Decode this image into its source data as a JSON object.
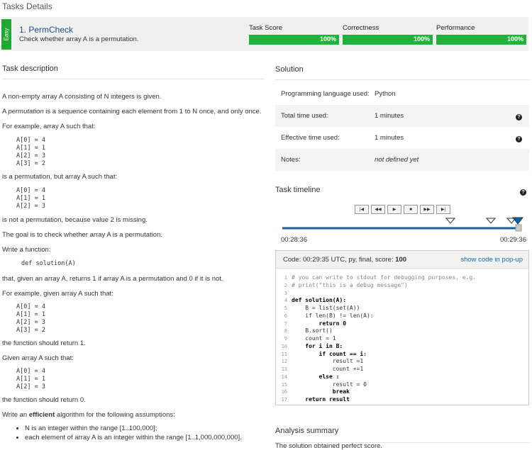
{
  "page_title": "Tasks Details",
  "task": {
    "difficulty": "Easy",
    "name": "1. PermCheck",
    "subtitle": "Check whether array A is a permutation.",
    "metrics": [
      {
        "label": "Task Score",
        "value": "100%",
        "fraction": 1.0
      },
      {
        "label": "Correctness",
        "value": "100%",
        "fraction": 1.0
      },
      {
        "label": "Performance",
        "value": "100%",
        "fraction": 1.0
      }
    ]
  },
  "description": {
    "title": "Task description",
    "p1": "A non-empty array A consisting of N integers is given.",
    "p2_pre": "A ",
    "p2_em": "permutation",
    "p2_post": " is a sequence containing each element from 1 to N once, and only once.",
    "p3": "For example, array A such that:",
    "ex1": [
      "A[0] = 4",
      "A[1] = 1",
      "A[2] = 3",
      "A[3] = 2"
    ],
    "p4": "is a permutation, but array A such that:",
    "ex2": [
      "A[0] = 4",
      "A[1] = 1",
      "A[2] = 3"
    ],
    "p5": "is not a permutation, because value 2 is missing.",
    "p6": "The goal is to check whether array A is a permutation.",
    "p7": "Write a function:",
    "signature": "def solution(A)",
    "p8": "that, given an array A, returns 1 if array A is a permutation and 0 if it is not.",
    "p9": "For example, given array A such that:",
    "ex3": [
      "A[0] = 4",
      "A[1] = 1",
      "A[2] = 3",
      "A[3] = 2"
    ],
    "p10": "the function should return 1.",
    "p11": "Given array A such that:",
    "ex4": [
      "A[0] = 4",
      "A[1] = 1",
      "A[2] = 3"
    ],
    "p12": "the function should return 0.",
    "p13_pre": "Write an ",
    "p13_strong": "efficient",
    "p13_post": " algorithm for the following assumptions:",
    "bullets": [
      "N is an integer within the range [1..100,000];",
      "each element of array A is an integer within the range [1..1,000,000,000]."
    ]
  },
  "solution": {
    "title": "Solution",
    "rows": [
      {
        "key": "Programming language used:",
        "value": "Python",
        "help": false
      },
      {
        "key": "Total time used:",
        "value": "1 minutes",
        "help": true
      },
      {
        "key": "Effective time used:",
        "value": "1 minutes",
        "help": true
      },
      {
        "key": "Notes:",
        "value": "not defined yet",
        "help": false
      }
    ]
  },
  "timeline": {
    "title": "Task timeline",
    "controls": [
      "first",
      "rewind",
      "play",
      "stop",
      "forward",
      "last"
    ],
    "start_time": "00:28:36",
    "end_time": "00:29:36"
  },
  "code": {
    "header": "Code: 00:29:35 UTC, py, final, score: ",
    "score": "100",
    "popup_link": "show code in pop-up",
    "lines": [
      "# you can write to stdout for debugging purposes, e.g.",
      "# print(\"this is a debug message\")",
      "",
      "def solution(A):",
      "    B = list(set(A))",
      "    if len(B) != len(A):",
      "        return 0",
      "    B.sort()",
      "    count = 1",
      "    for i in B:",
      "        if count == i:",
      "            result =1",
      "            count +=1",
      "        else :",
      "            result = 0",
      "            break",
      "    return result"
    ]
  },
  "analysis": {
    "title": "Analysis summary",
    "text": "The solution obtained perfect score."
  },
  "colors": {
    "success": "#21b23b",
    "link": "#1a4f86",
    "badge": "#1fa832"
  },
  "icons": [
    "help-icon",
    "first-icon",
    "rewind-icon",
    "play-icon",
    "stop-icon",
    "forward-icon",
    "last-icon",
    "timeline-marker-icon"
  ]
}
